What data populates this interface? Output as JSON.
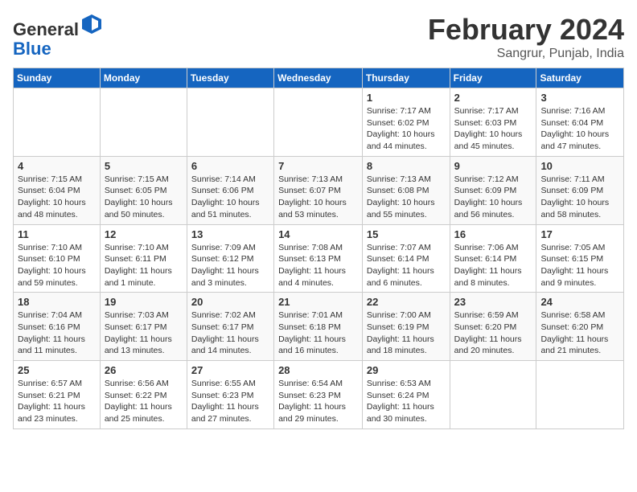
{
  "header": {
    "logo_general": "General",
    "logo_blue": "Blue",
    "title": "February 2024",
    "location": "Sangrur, Punjab, India"
  },
  "weekdays": [
    "Sunday",
    "Monday",
    "Tuesday",
    "Wednesday",
    "Thursday",
    "Friday",
    "Saturday"
  ],
  "weeks": [
    [
      {
        "day": "",
        "detail": ""
      },
      {
        "day": "",
        "detail": ""
      },
      {
        "day": "",
        "detail": ""
      },
      {
        "day": "",
        "detail": ""
      },
      {
        "day": "1",
        "detail": "Sunrise: 7:17 AM\nSunset: 6:02 PM\nDaylight: 10 hours\nand 44 minutes."
      },
      {
        "day": "2",
        "detail": "Sunrise: 7:17 AM\nSunset: 6:03 PM\nDaylight: 10 hours\nand 45 minutes."
      },
      {
        "day": "3",
        "detail": "Sunrise: 7:16 AM\nSunset: 6:04 PM\nDaylight: 10 hours\nand 47 minutes."
      }
    ],
    [
      {
        "day": "4",
        "detail": "Sunrise: 7:15 AM\nSunset: 6:04 PM\nDaylight: 10 hours\nand 48 minutes."
      },
      {
        "day": "5",
        "detail": "Sunrise: 7:15 AM\nSunset: 6:05 PM\nDaylight: 10 hours\nand 50 minutes."
      },
      {
        "day": "6",
        "detail": "Sunrise: 7:14 AM\nSunset: 6:06 PM\nDaylight: 10 hours\nand 51 minutes."
      },
      {
        "day": "7",
        "detail": "Sunrise: 7:13 AM\nSunset: 6:07 PM\nDaylight: 10 hours\nand 53 minutes."
      },
      {
        "day": "8",
        "detail": "Sunrise: 7:13 AM\nSunset: 6:08 PM\nDaylight: 10 hours\nand 55 minutes."
      },
      {
        "day": "9",
        "detail": "Sunrise: 7:12 AM\nSunset: 6:09 PM\nDaylight: 10 hours\nand 56 minutes."
      },
      {
        "day": "10",
        "detail": "Sunrise: 7:11 AM\nSunset: 6:09 PM\nDaylight: 10 hours\nand 58 minutes."
      }
    ],
    [
      {
        "day": "11",
        "detail": "Sunrise: 7:10 AM\nSunset: 6:10 PM\nDaylight: 10 hours\nand 59 minutes."
      },
      {
        "day": "12",
        "detail": "Sunrise: 7:10 AM\nSunset: 6:11 PM\nDaylight: 11 hours\nand 1 minute."
      },
      {
        "day": "13",
        "detail": "Sunrise: 7:09 AM\nSunset: 6:12 PM\nDaylight: 11 hours\nand 3 minutes."
      },
      {
        "day": "14",
        "detail": "Sunrise: 7:08 AM\nSunset: 6:13 PM\nDaylight: 11 hours\nand 4 minutes."
      },
      {
        "day": "15",
        "detail": "Sunrise: 7:07 AM\nSunset: 6:14 PM\nDaylight: 11 hours\nand 6 minutes."
      },
      {
        "day": "16",
        "detail": "Sunrise: 7:06 AM\nSunset: 6:14 PM\nDaylight: 11 hours\nand 8 minutes."
      },
      {
        "day": "17",
        "detail": "Sunrise: 7:05 AM\nSunset: 6:15 PM\nDaylight: 11 hours\nand 9 minutes."
      }
    ],
    [
      {
        "day": "18",
        "detail": "Sunrise: 7:04 AM\nSunset: 6:16 PM\nDaylight: 11 hours\nand 11 minutes."
      },
      {
        "day": "19",
        "detail": "Sunrise: 7:03 AM\nSunset: 6:17 PM\nDaylight: 11 hours\nand 13 minutes."
      },
      {
        "day": "20",
        "detail": "Sunrise: 7:02 AM\nSunset: 6:17 PM\nDaylight: 11 hours\nand 14 minutes."
      },
      {
        "day": "21",
        "detail": "Sunrise: 7:01 AM\nSunset: 6:18 PM\nDaylight: 11 hours\nand 16 minutes."
      },
      {
        "day": "22",
        "detail": "Sunrise: 7:00 AM\nSunset: 6:19 PM\nDaylight: 11 hours\nand 18 minutes."
      },
      {
        "day": "23",
        "detail": "Sunrise: 6:59 AM\nSunset: 6:20 PM\nDaylight: 11 hours\nand 20 minutes."
      },
      {
        "day": "24",
        "detail": "Sunrise: 6:58 AM\nSunset: 6:20 PM\nDaylight: 11 hours\nand 21 minutes."
      }
    ],
    [
      {
        "day": "25",
        "detail": "Sunrise: 6:57 AM\nSunset: 6:21 PM\nDaylight: 11 hours\nand 23 minutes."
      },
      {
        "day": "26",
        "detail": "Sunrise: 6:56 AM\nSunset: 6:22 PM\nDaylight: 11 hours\nand 25 minutes."
      },
      {
        "day": "27",
        "detail": "Sunrise: 6:55 AM\nSunset: 6:23 PM\nDaylight: 11 hours\nand 27 minutes."
      },
      {
        "day": "28",
        "detail": "Sunrise: 6:54 AM\nSunset: 6:23 PM\nDaylight: 11 hours\nand 29 minutes."
      },
      {
        "day": "29",
        "detail": "Sunrise: 6:53 AM\nSunset: 6:24 PM\nDaylight: 11 hours\nand 30 minutes."
      },
      {
        "day": "",
        "detail": ""
      },
      {
        "day": "",
        "detail": ""
      }
    ]
  ]
}
